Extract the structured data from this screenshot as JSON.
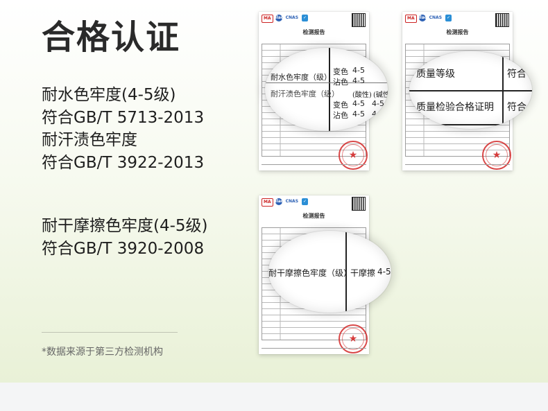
{
  "title": "合格认证",
  "claims": {
    "block1": [
      "耐水色牢度(4-5级)",
      "符合GB/T 5713-2013",
      "耐汗渍色牢度",
      "符合GB/T 3922-2013"
    ],
    "block2": [
      "耐干摩擦色牢度(4-5级)",
      "符合GB/T 3920-2008"
    ]
  },
  "footnote": "*数据来源于第三方检测机构",
  "report": {
    "heading": "检测报告",
    "logos": [
      "MA",
      "ilac",
      "CNAS",
      "✓"
    ],
    "stamp_symbol": "★"
  },
  "lens1": {
    "row1_label": "耐水色牢度（级）",
    "row1_sub1": "变色",
    "row1_val1": "4-5",
    "row1_sub2": "沾色",
    "row1_val2": "4-5",
    "row2_label": "耐汗渍色牢度（级）",
    "row2_head_acid": "(酸性)",
    "row2_head_alk": "(碱性",
    "row2_sub1": "变色",
    "row2_val1a": "4-5",
    "row2_val1b": "4-5",
    "row2_sub2": "沾色",
    "row2_val2a": "4-5",
    "row2_val2b": "4-"
  },
  "lens2": {
    "row1_label": "质量等级",
    "row1_value": "符合",
    "row2_label": "质量检验合格证明",
    "row2_value": "符合"
  },
  "lens3": {
    "label": "耐干摩擦色牢度（级）",
    "sub": "干摩擦",
    "value": "4-5"
  }
}
